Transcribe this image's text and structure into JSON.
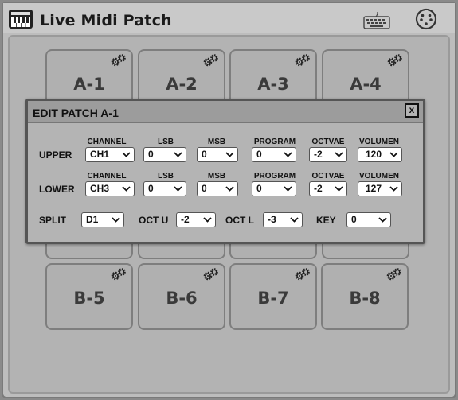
{
  "app": {
    "title": "Live Midi Patch"
  },
  "icons": {
    "app": "piano-keyboard-icon",
    "keyboard": "keyboard-icon",
    "midi": "midi-connector-icon",
    "settings": "gear-icon"
  },
  "pads": [
    "A-1",
    "A-2",
    "A-3",
    "A-4",
    "B-5",
    "B-6",
    "B-7",
    "B-8"
  ],
  "dialog": {
    "title": "EDIT PATCH A-1",
    "close_label": "x",
    "headers": {
      "channel": "CHANNEL",
      "lsb": "LSB",
      "msb": "MSB",
      "program": "PROGRAM",
      "octave": "OCTVAE",
      "volume": "VOLUMEN"
    },
    "upper": {
      "label": "UPPER",
      "channel": "CH1",
      "lsb": "0",
      "msb": "0",
      "program": "0",
      "octave": "-2",
      "volume": "120"
    },
    "lower": {
      "label": "LOWER",
      "channel": "CH3",
      "lsb": "0",
      "msb": "0",
      "program": "0",
      "octave": "-2",
      "volume": "127"
    },
    "bottom": {
      "split_label": "SPLIT",
      "split_value": "D1",
      "oct_u_label": "OCT U",
      "oct_u_value": "-2",
      "oct_l_label": "OCT L",
      "oct_l_value": "-3",
      "key_label": "KEY",
      "key_value": "0"
    }
  }
}
